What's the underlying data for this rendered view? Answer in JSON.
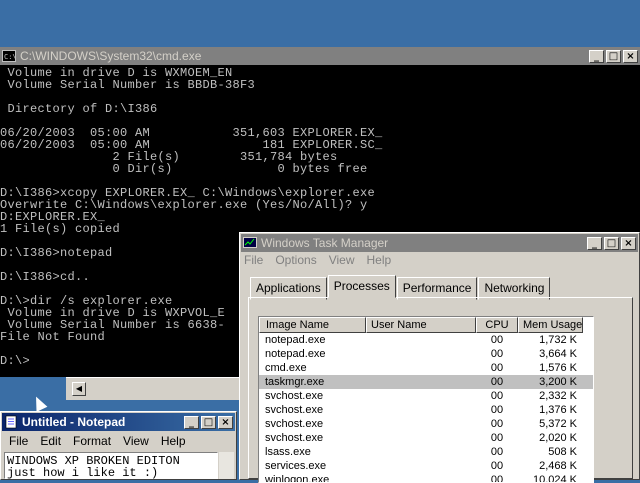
{
  "cmd": {
    "title": "C:\\WINDOWS\\System32\\cmd.exe",
    "lines": [
      " Volume in drive D is WXMOEM_EN",
      " Volume Serial Number is BBDB-38F3",
      "",
      " Directory of D:\\I386",
      "",
      "06/20/2003  05:00 AM           351,603 EXPLORER.EX_",
      "06/20/2003  05:00 AM               181 EXPLORER.SC_",
      "               2 File(s)        351,784 bytes",
      "               0 Dir(s)              0 bytes free",
      "",
      "D:\\I386>xcopy EXPLORER.EX_ C:\\Windows\\explorer.exe",
      "Overwrite C:\\Windows\\explorer.exe (Yes/No/All)? y",
      "D:EXPLORER.EX_",
      "1 File(s) copied",
      "",
      "D:\\I386>notepad",
      "",
      "D:\\I386>cd..",
      "",
      "D:\\>dir /s explorer.exe",
      " Volume in drive D is WXPVOL_E",
      " Volume Serial Number is 6638-",
      "File Not Found",
      "",
      "D:\\>"
    ]
  },
  "taskmgr": {
    "title": "Windows Task Manager",
    "menu": [
      "File",
      "Options",
      "View",
      "Help"
    ],
    "tabs": [
      "Applications",
      "Processes",
      "Performance",
      "Networking"
    ],
    "active_tab": "Processes",
    "columns": [
      "Image Name",
      "User Name",
      "CPU",
      "Mem Usage"
    ],
    "rows": [
      {
        "name": "notepad.exe",
        "user": "",
        "cpu": "00",
        "mem": "1,732 K"
      },
      {
        "name": "notepad.exe",
        "user": "",
        "cpu": "00",
        "mem": "3,664 K"
      },
      {
        "name": "cmd.exe",
        "user": "",
        "cpu": "00",
        "mem": "1,576 K"
      },
      {
        "name": "taskmgr.exe",
        "user": "",
        "cpu": "00",
        "mem": "3,200 K"
      },
      {
        "name": "svchost.exe",
        "user": "",
        "cpu": "00",
        "mem": "2,332 K"
      },
      {
        "name": "svchost.exe",
        "user": "",
        "cpu": "00",
        "mem": "1,376 K"
      },
      {
        "name": "svchost.exe",
        "user": "",
        "cpu": "00",
        "mem": "5,372 K"
      },
      {
        "name": "svchost.exe",
        "user": "",
        "cpu": "00",
        "mem": "2,020 K"
      },
      {
        "name": "lsass.exe",
        "user": "",
        "cpu": "00",
        "mem": "508 K"
      },
      {
        "name": "services.exe",
        "user": "",
        "cpu": "00",
        "mem": "2,468 K"
      },
      {
        "name": "winlogon.exe",
        "user": "",
        "cpu": "00",
        "mem": "10,024 K"
      }
    ],
    "selected_row": "taskmgr.exe"
  },
  "notepad": {
    "title": "Untitled - Notepad",
    "menu": [
      "File",
      "Edit",
      "Format",
      "View",
      "Help"
    ],
    "text": "WINDOWS XP BROKEN EDITON\njust how i like it :)"
  },
  "icons": {
    "cmd": "console-icon",
    "taskmgr": "taskmgr-icon",
    "notepad": "notepad-icon"
  }
}
